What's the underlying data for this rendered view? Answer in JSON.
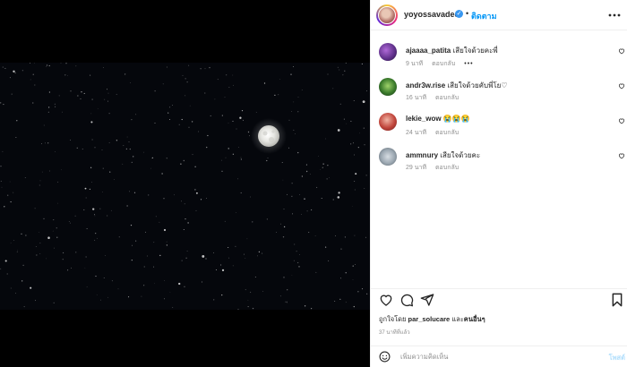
{
  "post": {
    "username": "yoyossavadee",
    "follow_label": "ติดตาม",
    "separator": "•",
    "more_label": "•••"
  },
  "comments": [
    {
      "username": "ajaaaa_patita",
      "text": "เสียใจด้วยคะพี่",
      "time": "9 นาที",
      "reply": "ตอบกลับ",
      "more": "•••"
    },
    {
      "username": "andr3w.rise",
      "text": "เสียใจด้วยคับพี่โย♡",
      "time": "16 นาที",
      "reply": "ตอบกลับ"
    },
    {
      "username": "lekie_wow",
      "text": "😭😭😭",
      "time": "24 นาที",
      "reply": "ตอบกลับ"
    },
    {
      "username": "ammnury",
      "text": "เสียใจด้วยคะ",
      "time": "29 นาที",
      "reply": "ตอบกลับ"
    }
  ],
  "likes": {
    "prefix": "ถูกใจโดย",
    "user": "par_solucare",
    "middle": "และ",
    "others": "คนอื่นๆ"
  },
  "timestamp": "37 นาทีที่แล้ว",
  "add_comment": {
    "placeholder": "เพิ่มความคิดเห็น",
    "post_label": "โพสต์"
  },
  "icons": {
    "verified": "verified-badge-icon",
    "heart": "heart-icon",
    "comment": "comment-icon",
    "share": "paper-plane-icon",
    "save": "bookmark-icon",
    "emoji": "smiley-icon"
  },
  "colors": {
    "link_blue": "#0095f6",
    "verified_blue": "#3897f0",
    "muted": "#8e8e8e",
    "night_sky": "#05070c"
  }
}
